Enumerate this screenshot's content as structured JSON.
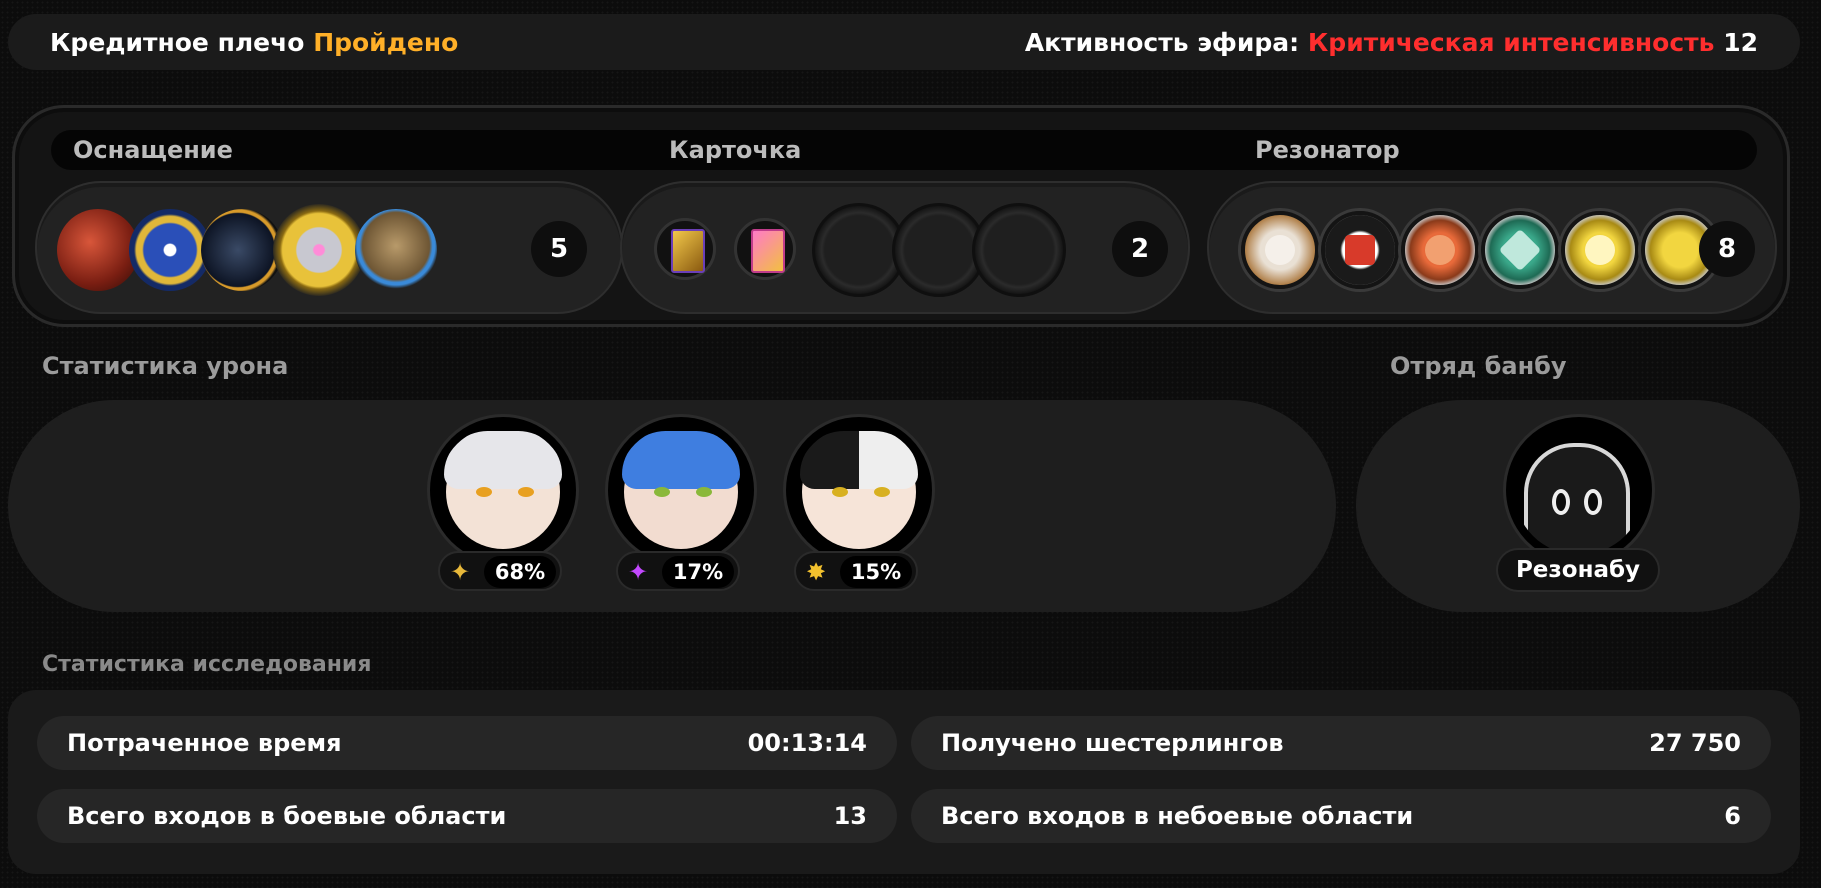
{
  "header": {
    "credit_label": "Кредитное плечо",
    "credit_status": "Пройдено",
    "ether_label": "Активность эфира:",
    "ether_status": "Критическая интенсивность",
    "ether_value": "12"
  },
  "loadout": {
    "equipment": {
      "label": "Оснащение",
      "count": "5"
    },
    "card": {
      "label": "Карточка",
      "count": "2"
    },
    "resonator": {
      "label": "Резонатор",
      "count": "8"
    }
  },
  "damage": {
    "title": "Статистика урона",
    "agents": [
      {
        "percent": "68%",
        "icon": "gold-diamond-icon",
        "color": "#e8b83a"
      },
      {
        "percent": "17%",
        "icon": "ether-sparkle-icon",
        "color": "#c348ff"
      },
      {
        "percent": "15%",
        "icon": "gold-burst-icon",
        "color": "#f2c12e"
      }
    ]
  },
  "bangboo": {
    "title": "Отряд банбу",
    "name": "Резонабу"
  },
  "exploration": {
    "title": "Статистика исследования",
    "rows": [
      {
        "label": "Потраченное время",
        "value": "00:13:14"
      },
      {
        "label": "Получено шестерлингов",
        "value": "27 750"
      },
      {
        "label": "Всего входов в боевые области",
        "value": "13"
      },
      {
        "label": "Всего входов в небоевые области",
        "value": "6"
      }
    ]
  },
  "colors": {
    "accent_orange": "#ffb028",
    "accent_red": "#ff2e2e"
  }
}
